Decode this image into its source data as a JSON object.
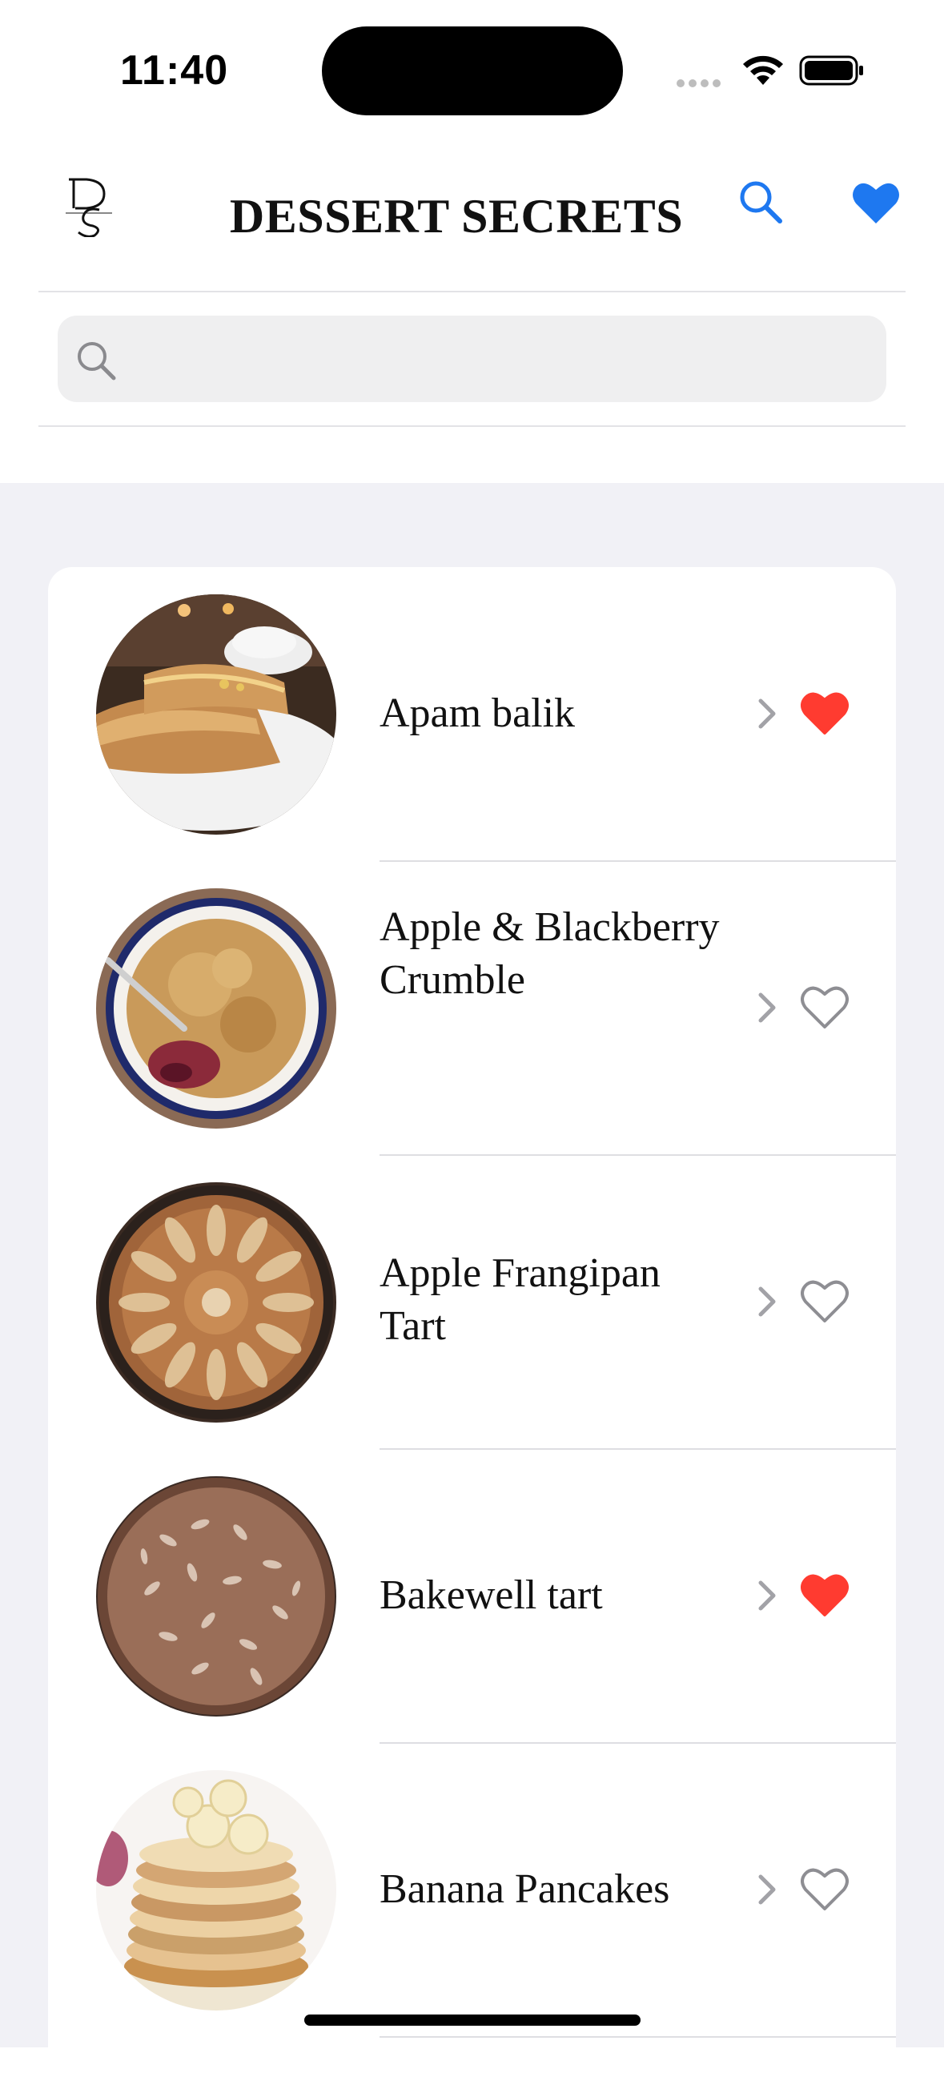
{
  "status_bar": {
    "time": "11:40"
  },
  "header": {
    "title": "DESSERT SECRETS",
    "logo_icon": "ds-monogram-logo",
    "search_icon": "search-icon",
    "favorites_icon": "heart-filled-icon",
    "accent_color": "#1E78F0"
  },
  "search": {
    "placeholder": "",
    "value": ""
  },
  "desserts": [
    {
      "name": "Apam balik",
      "favorite": true
    },
    {
      "name": "Apple & Blackberry Crumble",
      "favorite": false
    },
    {
      "name": "Apple Frangipan Tart",
      "favorite": false
    },
    {
      "name": "Bakewell tart",
      "favorite": true
    },
    {
      "name": "Banana Pancakes",
      "favorite": false
    }
  ],
  "colors": {
    "favorite_on": "#FF3B30",
    "favorite_off": "#8E8E93",
    "list_background": "#F1F1F6"
  }
}
